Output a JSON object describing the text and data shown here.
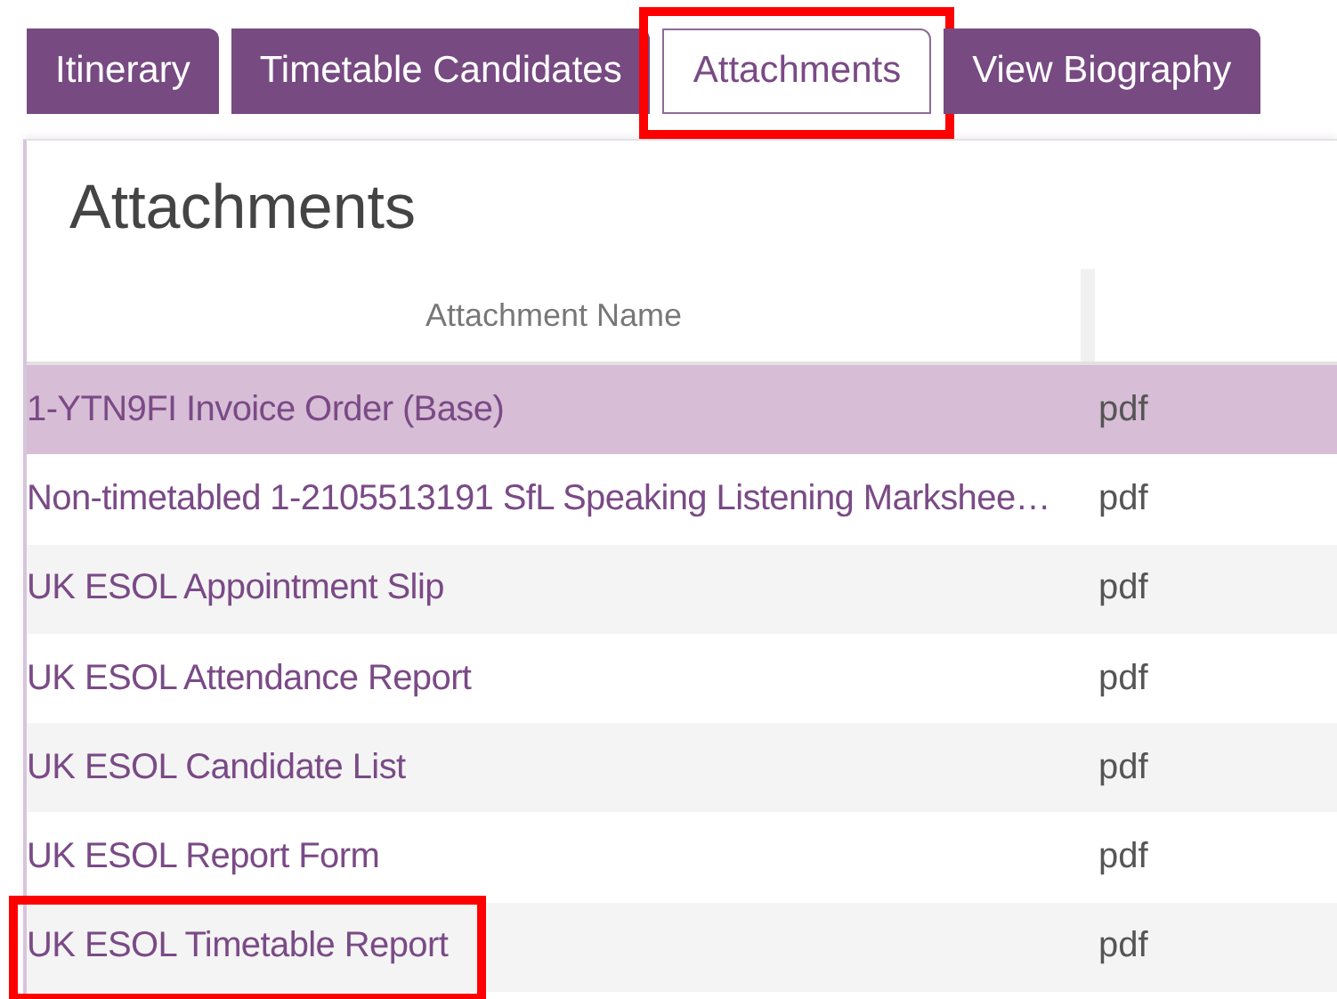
{
  "tabs": [
    {
      "label": "Itinerary",
      "selected": false,
      "highlighted": false
    },
    {
      "label": "Timetable Candidates",
      "selected": false,
      "highlighted": false
    },
    {
      "label": "Attachments",
      "selected": true,
      "highlighted": true
    },
    {
      "label": "View Biography",
      "selected": false,
      "highlighted": false
    }
  ],
  "panel": {
    "title": "Attachments"
  },
  "table": {
    "columns": [
      "Attachment Name"
    ],
    "rows": [
      {
        "name": "1-YTN9FI Invoice Order (Base)",
        "type": "pdf",
        "selected": true,
        "highlighted": false
      },
      {
        "name": "Non-timetabled 1-2105513191 SfL Speaking Listening Markshee…",
        "type": "pdf",
        "selected": false,
        "highlighted": false
      },
      {
        "name": "UK ESOL Appointment Slip",
        "type": "pdf",
        "selected": false,
        "highlighted": false
      },
      {
        "name": "UK ESOL Attendance Report",
        "type": "pdf",
        "selected": false,
        "highlighted": false
      },
      {
        "name": "UK ESOL Candidate List",
        "type": "pdf",
        "selected": false,
        "highlighted": false
      },
      {
        "name": "UK ESOL Report Form",
        "type": "pdf",
        "selected": false,
        "highlighted": false
      },
      {
        "name": "UK ESOL Timetable Report",
        "type": "pdf",
        "selected": false,
        "highlighted": true
      }
    ]
  }
}
